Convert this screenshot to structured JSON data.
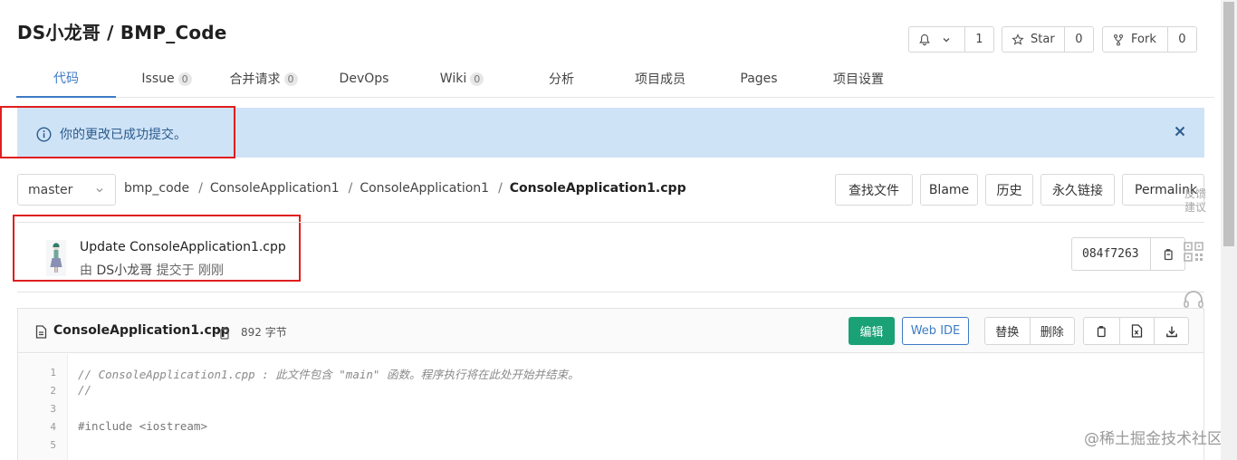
{
  "repo": {
    "title": "DS小龙哥 / BMP_Code"
  },
  "top_actions": {
    "watch_count": "1",
    "star_label": "Star",
    "star_count": "0",
    "fork_label": "Fork",
    "fork_count": "0"
  },
  "tabs": [
    {
      "label": "代码",
      "active": true
    },
    {
      "label": "Issue",
      "badge": "0"
    },
    {
      "label": "合并请求",
      "badge": "0"
    },
    {
      "label": "DevOps"
    },
    {
      "label": "Wiki",
      "badge": "0"
    },
    {
      "label": "分析"
    },
    {
      "label": "项目成员"
    },
    {
      "label": "Pages"
    },
    {
      "label": "项目设置"
    }
  ],
  "alert": {
    "message": "你的更改已成功提交。"
  },
  "branch": {
    "selected": "master"
  },
  "breadcrumb": {
    "root": "bmp_code",
    "dir1": "ConsoleApplication1",
    "dir2": "ConsoleApplication1",
    "file": "ConsoleApplication1.cpp"
  },
  "file_actions": {
    "find": "查找文件",
    "blame": "Blame",
    "history": "历史",
    "permalink_cn": "永久链接",
    "permalink": "Permalink"
  },
  "commit": {
    "title": "Update ConsoleApplication1.cpp",
    "prefix": "由",
    "author": "DS小龙哥",
    "suffix": "提交于 刚刚",
    "sha": "084f7263"
  },
  "side_tools": {
    "feedback": "反馈建议"
  },
  "file": {
    "name": "ConsoleApplication1.cpp",
    "size": "892 字节",
    "edit": "编辑",
    "webide": "Web IDE",
    "replace": "替换",
    "delete": "删除"
  },
  "code_lines": [
    {
      "n": "1",
      "text": "// ConsoleApplication1.cpp : 此文件包含 \"main\" 函数。程序执行将在此处开始并结束。"
    },
    {
      "n": "2",
      "text": "//"
    },
    {
      "n": "3",
      "text": ""
    },
    {
      "n": "4",
      "text": "#include <iostream>"
    },
    {
      "n": "5",
      "text": ""
    }
  ],
  "watermark": "@稀土掘金技术社区",
  "colors": {
    "accent": "#3d7bc4",
    "success": "#1aa176",
    "alert_bg": "#cfe3f7",
    "highlight_red": "#e01e1e"
  }
}
